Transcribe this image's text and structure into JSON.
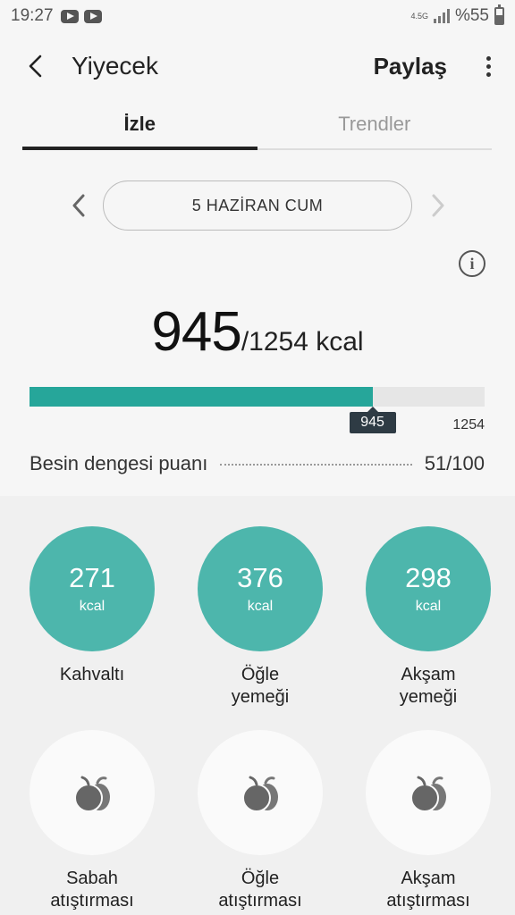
{
  "status": {
    "time": "19:27",
    "network": "4.5G",
    "battery": "%55",
    "battery_level": 0.55
  },
  "header": {
    "title": "Yiyecek",
    "share": "Paylaş"
  },
  "tabs": [
    {
      "label": "İzle",
      "active": true
    },
    {
      "label": "Trendler",
      "active": false
    }
  ],
  "date": {
    "label": "5 HAZİRAN CUM"
  },
  "summary": {
    "consumed": "945",
    "target_text": "/1254 kcal",
    "marker": "945",
    "target": "1254",
    "progress_fraction": 0.7536,
    "balance_label": "Besin dengesi puanı",
    "balance_value": "51/100"
  },
  "meals": [
    {
      "value": "271",
      "unit": "kcal",
      "label": "Kahvaltı"
    },
    {
      "value": "376",
      "unit": "kcal",
      "label": "Öğle\nyemeği"
    },
    {
      "value": "298",
      "unit": "kcal",
      "label": "Akşam\nyemeği"
    }
  ],
  "snacks": [
    {
      "label": "Sabah\natıştırması",
      "icon": "fruit-icon"
    },
    {
      "label": "Öğle\natıştırması",
      "icon": "fruit-icon"
    },
    {
      "label": "Akşam\natıştırması",
      "icon": "fruit-icon"
    }
  ],
  "colors": {
    "accent": "#4db6ac",
    "bar": "#26a69a",
    "marker": "#2e3b44"
  }
}
